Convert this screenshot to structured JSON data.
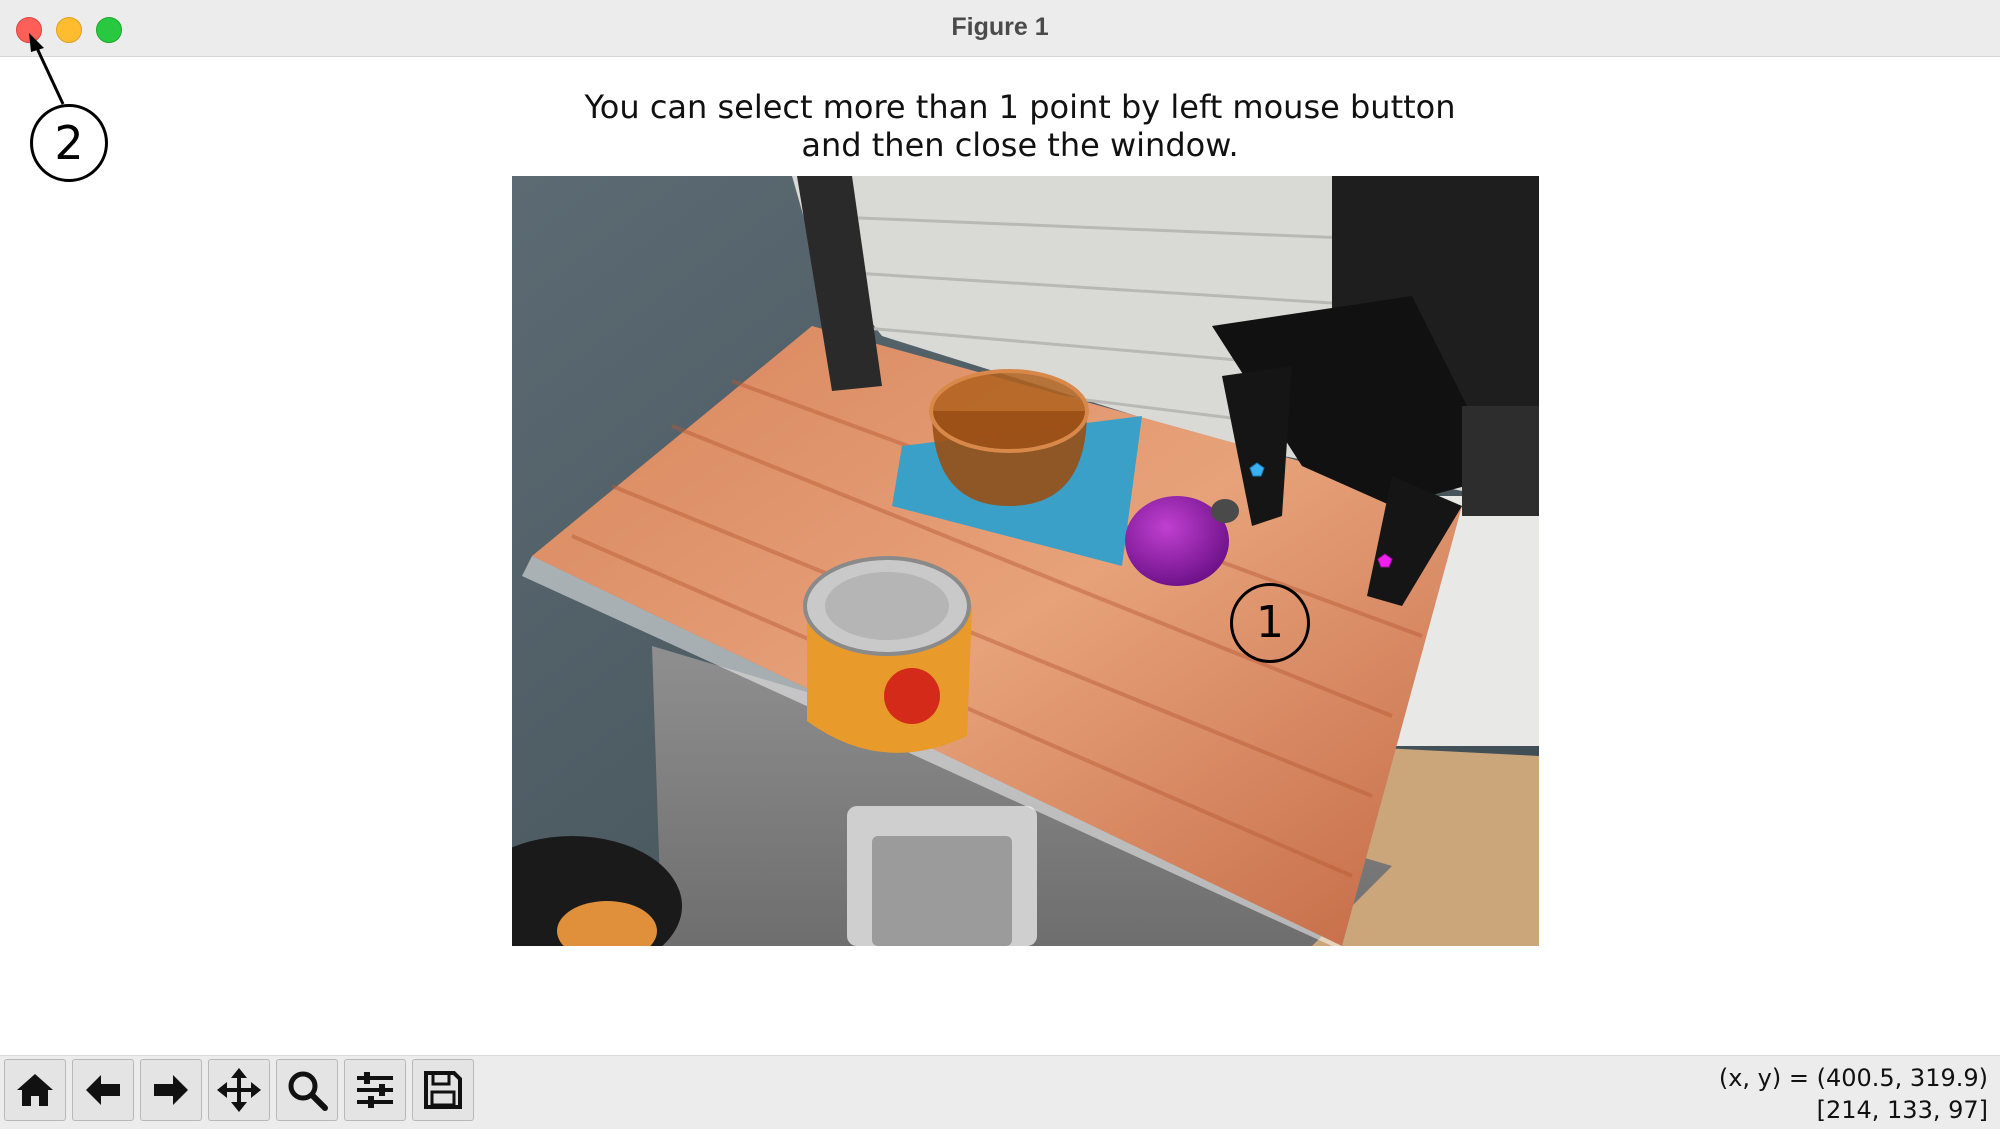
{
  "window": {
    "title": "Figure 1",
    "controls": [
      "close-button",
      "minimize-button",
      "maximize-button"
    ]
  },
  "figure": {
    "title_line1": "You can select more than 1 point by left mouse button",
    "title_line2": "and then close the window."
  },
  "annotations": {
    "one": "1",
    "two": "2"
  },
  "markers": [
    {
      "name": "blue-point-marker",
      "color": "#3ab0f0"
    },
    {
      "name": "magenta-point-marker",
      "color": "#f020f0"
    }
  ],
  "toolbar": {
    "buttons": [
      "home-icon",
      "back-arrow-icon",
      "forward-arrow-icon",
      "pan-icon",
      "zoom-icon",
      "configure-subplots-icon",
      "save-icon"
    ]
  },
  "status": {
    "xy": "(x, y) = (400.5, 319.9)",
    "rgb": "[214, 133, 97]"
  }
}
